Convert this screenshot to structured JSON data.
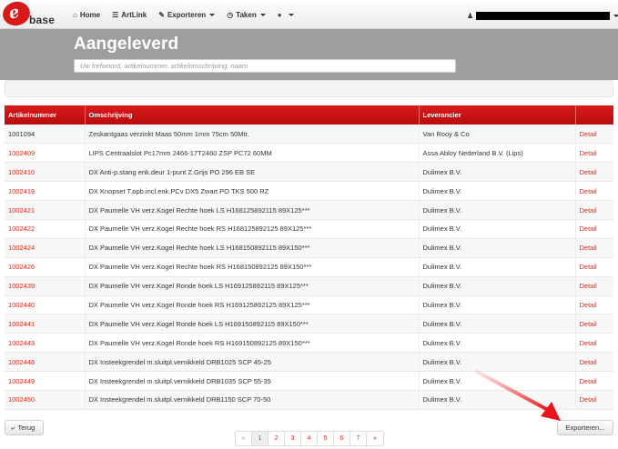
{
  "app": {
    "logo_text": "base",
    "logo_mark": "e"
  },
  "nav": {
    "items": [
      {
        "label": "Home",
        "icon": "home-icon",
        "glyph": "⌂",
        "caret": false
      },
      {
        "label": "ArtLink",
        "icon": "list-icon",
        "glyph": "☰",
        "caret": false
      },
      {
        "label": "Exporteren",
        "icon": "edit-icon",
        "glyph": "✎",
        "caret": true
      },
      {
        "label": "Taken",
        "icon": "clock-icon",
        "glyph": "◷",
        "caret": true
      },
      {
        "label": "",
        "icon": "settings-icon",
        "glyph": "●",
        "caret": true
      }
    ],
    "user_icon": "user-icon"
  },
  "header": {
    "title": "Aangeleverd",
    "search_placeholder": "Uw trefwoord, artikelnummer, artikelomschrijving, naam"
  },
  "table": {
    "columns": [
      "Artikelnummer",
      "Omschrijving",
      "Leverancier",
      ""
    ],
    "rows": [
      {
        "nummer": "1001094",
        "omschrijving": "Zeskantgaas verzinkt Maas 50mm 1mm 75cm 50Mtr.",
        "leverancier": "Van Rooy & Co",
        "action": "Detail",
        "linked": false
      },
      {
        "nummer": "1002409",
        "omschrijving": "LIPS Centraalslot Pc17mm 2466-17T2460 ZSP PC72 60MM",
        "leverancier": "Assa Abloy Nederland B.V. (Lips)",
        "action": "Detail",
        "linked": true
      },
      {
        "nummer": "1002410",
        "omschrijving": "DX Anti-p.stang enk.deur 1-punt Z.Grijs PO 296 EB SE",
        "leverancier": "Dulimex B.V.",
        "action": "Detail",
        "linked": true
      },
      {
        "nummer": "1002419",
        "omschrijving": "DX Knopset T.opb.incl.enk.PCv DX5 Zwart PO TKS 500 RZ",
        "leverancier": "Dulimex B.V.",
        "action": "Detail",
        "linked": true
      },
      {
        "nummer": "1002421",
        "omschrijving": "DX Paumelle VH verz.Kogel Rechte hoek LS H168125892115 89X125***",
        "leverancier": "Dulimex B.V.",
        "action": "Detail",
        "linked": true
      },
      {
        "nummer": "1002422",
        "omschrijving": "DX Paumelle VH verz.Kogel Rechte hoek RS H168125892125 89X125***",
        "leverancier": "Dulimex B.V.",
        "action": "Detail",
        "linked": true
      },
      {
        "nummer": "1002424",
        "omschrijving": "DX Paumelle VH verz.Kogel Rechte hoek LS H168150892115 89X150***",
        "leverancier": "Dulimex B.V.",
        "action": "Detail",
        "linked": true
      },
      {
        "nummer": "1002426",
        "omschrijving": "DX Paumelle VH verz.Kogel Rechte hoek RS H168150892125 89X150***",
        "leverancier": "Dulimex B.V.",
        "action": "Detail",
        "linked": true
      },
      {
        "nummer": "1002439",
        "omschrijving": "DX Paumelle VH verz.Kogel Ronde hoek LS H169125892115 89X125***",
        "leverancier": "Dulimex B.V.",
        "action": "Detail",
        "linked": true
      },
      {
        "nummer": "1002440",
        "omschrijving": "DX Paumelle VH verz.Kogel Ronde hoek RS H169125892125 89X125***",
        "leverancier": "Dulimex B.V.",
        "action": "Detail",
        "linked": true
      },
      {
        "nummer": "1002441",
        "omschrijving": "DX Paumelle VH verz.Kogel Ronde hoek LS H169150892115 89X150***",
        "leverancier": "Dulimex B.V.",
        "action": "Detail",
        "linked": true
      },
      {
        "nummer": "1002443",
        "omschrijving": "DX Paumelle VH verz.Kogel Ronde hoek RS H169150892125 89X150***",
        "leverancier": "Dulimex B.V.",
        "action": "Detail",
        "linked": true
      },
      {
        "nummer": "1002448",
        "omschrijving": "DX Insteekgrendel m.sluitpl.vernikkeld DRB1025 SCP 45-25",
        "leverancier": "Dulimex B.V.",
        "action": "Detail",
        "linked": true
      },
      {
        "nummer": "1002449",
        "omschrijving": "DX Insteekgrendel m.sluitpl.vernikkeld DRB1035 SCP 55-35",
        "leverancier": "Dulimex B.V.",
        "action": "Detail",
        "linked": true
      },
      {
        "nummer": "1002450",
        "omschrijving": "DX Insteekgrendel m.sluitpl.vernikkeld DRB1150 SCP 70-50",
        "leverancier": "Dulimex B.V.",
        "action": "Detail",
        "linked": true
      }
    ]
  },
  "footer": {
    "back_label": "Terug",
    "export_label": "Exporteren...",
    "pagination": [
      "«",
      "1",
      "2",
      "3",
      "4",
      "5",
      "6",
      "7",
      "»"
    ],
    "active_page": "1"
  },
  "colors": {
    "accent": "#d9281b",
    "header_bg": "#9e9e9e",
    "table_head": "#c91414"
  }
}
